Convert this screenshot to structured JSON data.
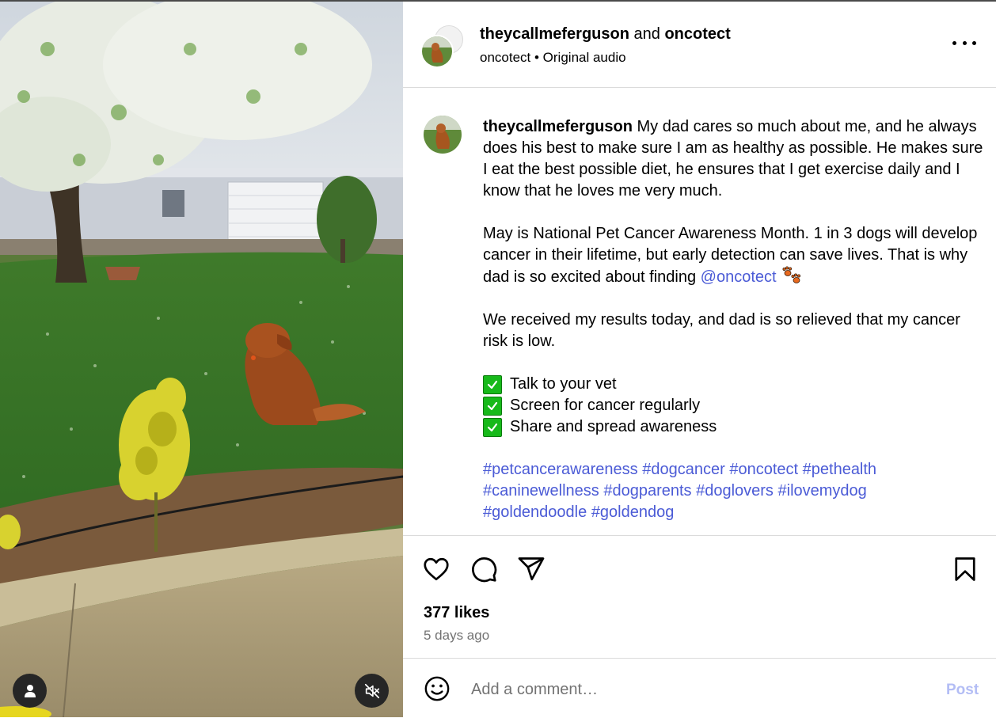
{
  "post": {
    "header": {
      "author": "theycallmeferguson",
      "conjunction": " and ",
      "collaborator": "oncotect",
      "audio_owner": "oncotect",
      "separator": " • ",
      "audio": "Original audio",
      "more_icon": "more-horizontal-icon"
    },
    "caption": {
      "username": "theycallmeferguson",
      "intro": " My dad cares so much about me, and he always does his best to make sure I am as healthy as possible. He makes sure I eat the best possible diet, he ensures that I get exercise daily and I know that he loves me very much.",
      "awareness": "May is National Pet Cancer Awareness Month. 1 in 3 dogs will develop cancer in their lifetime, but early detection can save lives. That is why dad is so excited about finding ",
      "mention": "@oncotect",
      "results": "We received my results today, and dad is so relieved that my cancer risk is low.",
      "checklist": [
        "Talk to your vet",
        "Screen for cancer regularly",
        "Share and spread awareness"
      ],
      "hashtags": [
        "#petcancerawareness",
        "#dogcancer",
        "#oncotect",
        "#pethealth",
        "#caninewellness",
        "#dogparents",
        "#doglovers",
        "#ilovemydog",
        "#goldendoodle",
        "#goldendog"
      ]
    },
    "actions": {
      "like_icon": "heart-icon",
      "comment_icon": "comment-icon",
      "share_icon": "send-icon",
      "save_icon": "bookmark-icon"
    },
    "likes": "377 likes",
    "posted": "5 days ago",
    "comment": {
      "placeholder": "Add a comment…",
      "post_label": "Post",
      "emoji_icon": "smiley-icon"
    },
    "media": {
      "tag_icon": "person-icon",
      "mute_icon": "speaker-muted-icon"
    }
  }
}
